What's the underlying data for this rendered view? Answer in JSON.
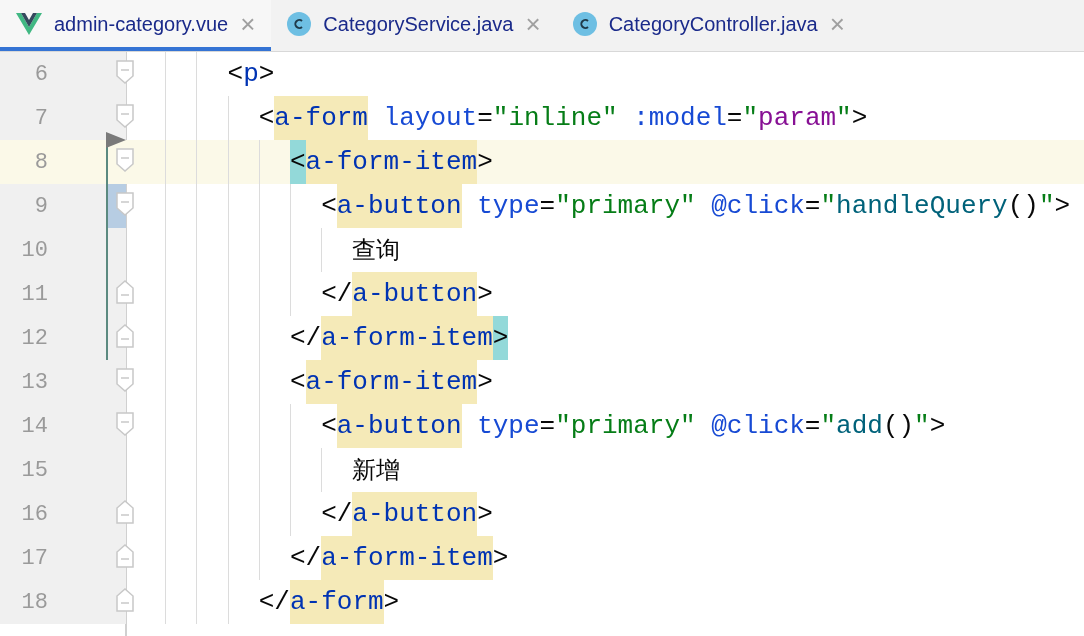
{
  "tabs": [
    {
      "label": "admin-category.vue",
      "kind": "vue",
      "selected": true,
      "close": "×"
    },
    {
      "label": "CategoryService.java",
      "kind": "class",
      "selected": false,
      "close": "×"
    },
    {
      "label": "CategoryController.java",
      "kind": "class",
      "selected": false,
      "close": "×"
    }
  ],
  "lines": [
    {
      "number": "6",
      "kind": "fold-open",
      "current": false,
      "changed": false,
      "marked": false,
      "tokens": [
        {
          "kind": "punct",
          "text": "<"
        },
        {
          "kind": "tag",
          "text": "p"
        },
        {
          "kind": "punct",
          "text": ">"
        }
      ],
      "children": [
        {
          "number": "7",
          "kind": "fold-open",
          "current": false,
          "changed": false,
          "marked": false,
          "tokens": [
            {
              "kind": "punct",
              "text": "<"
            },
            {
              "kind": "tag-usage",
              "text": "a-form"
            },
            {
              "kind": "attr",
              "text": " layout"
            },
            {
              "kind": "punct",
              "text": "="
            },
            {
              "kind": "string",
              "text": "\"inline\""
            },
            {
              "kind": "attr",
              "text": " :model"
            },
            {
              "kind": "punct",
              "text": "="
            },
            {
              "kind": "string",
              "text": "\""
            },
            {
              "kind": "var",
              "text": "param"
            },
            {
              "kind": "string",
              "text": "\""
            },
            {
              "kind": "punct",
              "text": ">"
            }
          ],
          "children": [
            {
              "number": "8",
              "kind": "fold-open",
              "current": true,
              "changed": true,
              "marked": false,
              "tokens": [
                {
                  "kind": "punct-brace",
                  "text": "<"
                },
                {
                  "kind": "tag-usage",
                  "text": "a-form-item"
                },
                {
                  "kind": "punct",
                  "text": ">"
                }
              ],
              "children": [
                {
                  "number": "9",
                  "kind": "fold-open",
                  "current": false,
                  "changed": true,
                  "marked": true,
                  "tokens": [
                    {
                      "kind": "punct",
                      "text": "<"
                    },
                    {
                      "kind": "tag-usage",
                      "text": "a-button"
                    },
                    {
                      "kind": "attr",
                      "text": " type"
                    },
                    {
                      "kind": "punct",
                      "text": "="
                    },
                    {
                      "kind": "string",
                      "text": "\"primary\""
                    },
                    {
                      "kind": "attr",
                      "text": " @click"
                    },
                    {
                      "kind": "punct",
                      "text": "="
                    },
                    {
                      "kind": "string",
                      "text": "\""
                    },
                    {
                      "kind": "func",
                      "text": "handleQuery"
                    },
                    {
                      "kind": "punct",
                      "text": "()"
                    },
                    {
                      "kind": "string",
                      "text": "\""
                    },
                    {
                      "kind": "punct",
                      "text": ">"
                    }
                  ],
                  "children": [
                    {
                      "number": "10",
                      "current": false,
                      "changed": true,
                      "marked": false,
                      "tokens": [
                        {
                          "kind": "text",
                          "text": "查询"
                        }
                      ]
                    }
                  ]
                },
                {
                  "number": "11",
                  "kind": "fold-close",
                  "current": false,
                  "changed": true,
                  "marked": false,
                  "tokens": [
                    {
                      "kind": "punct",
                      "text": "</"
                    },
                    {
                      "kind": "tag-usage",
                      "text": "a-button"
                    },
                    {
                      "kind": "punct",
                      "text": ">"
                    }
                  ]
                }
              ]
            },
            {
              "number": "12",
              "kind": "fold-close",
              "current": false,
              "changed": true,
              "marked": false,
              "tokens": [
                {
                  "kind": "punct",
                  "text": "</"
                },
                {
                  "kind": "tag-usage",
                  "text": "a-form-item"
                },
                {
                  "kind": "punct-brace",
                  "text": ">"
                }
              ]
            },
            {
              "number": "13",
              "kind": "fold-open",
              "current": false,
              "changed": false,
              "marked": false,
              "tokens": [
                {
                  "kind": "punct",
                  "text": "<"
                },
                {
                  "kind": "tag-usage",
                  "text": "a-form-item"
                },
                {
                  "kind": "punct",
                  "text": ">"
                }
              ],
              "children": [
                {
                  "number": "14",
                  "kind": "fold-open",
                  "current": false,
                  "changed": false,
                  "marked": false,
                  "tokens": [
                    {
                      "kind": "punct",
                      "text": "<"
                    },
                    {
                      "kind": "tag-usage",
                      "text": "a-button"
                    },
                    {
                      "kind": "attr",
                      "text": " type"
                    },
                    {
                      "kind": "punct",
                      "text": "="
                    },
                    {
                      "kind": "string",
                      "text": "\"primary\""
                    },
                    {
                      "kind": "attr",
                      "text": " @click"
                    },
                    {
                      "kind": "punct",
                      "text": "="
                    },
                    {
                      "kind": "string",
                      "text": "\""
                    },
                    {
                      "kind": "func",
                      "text": "add"
                    },
                    {
                      "kind": "punct",
                      "text": "()"
                    },
                    {
                      "kind": "string",
                      "text": "\""
                    },
                    {
                      "kind": "punct",
                      "text": ">"
                    }
                  ],
                  "children": [
                    {
                      "number": "15",
                      "current": false,
                      "changed": false,
                      "marked": false,
                      "tokens": [
                        {
                          "kind": "text",
                          "text": "新增"
                        }
                      ]
                    }
                  ]
                },
                {
                  "number": "16",
                  "kind": "fold-close",
                  "current": false,
                  "changed": false,
                  "marked": false,
                  "tokens": [
                    {
                      "kind": "punct",
                      "text": "</"
                    },
                    {
                      "kind": "tag-usage",
                      "text": "a-button"
                    },
                    {
                      "kind": "punct",
                      "text": ">"
                    }
                  ]
                }
              ]
            },
            {
              "number": "17",
              "kind": "fold-close",
              "current": false,
              "changed": false,
              "marked": false,
              "tokens": [
                {
                  "kind": "punct",
                  "text": "</"
                },
                {
                  "kind": "tag-usage",
                  "text": "a-form-item"
                },
                {
                  "kind": "punct",
                  "text": ">"
                }
              ]
            }
          ]
        },
        {
          "number": "18",
          "kind": "fold-close",
          "current": false,
          "changed": false,
          "marked": false,
          "tokens": [
            {
              "kind": "punct",
              "text": "</"
            },
            {
              "kind": "tag-usage",
              "text": "a-form"
            },
            {
              "kind": "punct",
              "text": ">"
            }
          ]
        }
      ]
    }
  ]
}
